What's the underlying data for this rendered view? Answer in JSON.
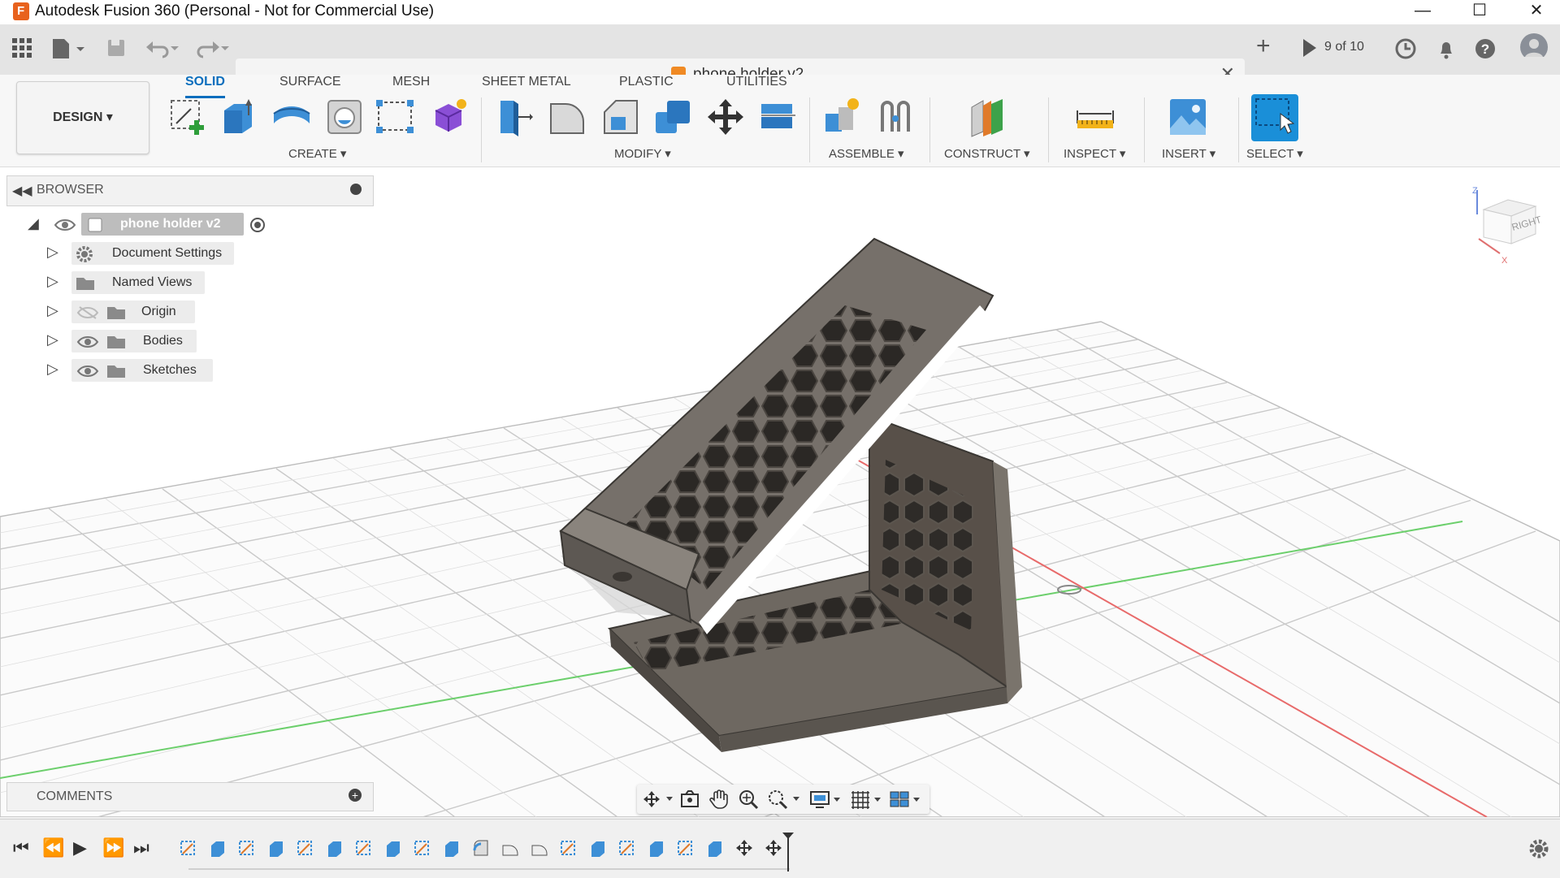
{
  "window": {
    "title": "Autodesk Fusion 360 (Personal - Not for Commercial Use)",
    "logo_letter": "F",
    "minimize_glyph": "—",
    "maximize_glyph": "☐",
    "close_glyph": "✕"
  },
  "tabbar": {
    "document_name": "phone holder v2",
    "close_glyph": "✕",
    "new_tab_glyph": "+",
    "job_status": "9 of 10"
  },
  "ribbon": {
    "workspace": "DESIGN ▾",
    "tabs": [
      "SOLID",
      "SURFACE",
      "MESH",
      "SHEET METAL",
      "PLASTIC",
      "UTILITIES"
    ],
    "active_tab": "SOLID",
    "groups": [
      "CREATE ▾",
      "MODIFY ▾",
      "ASSEMBLE ▾",
      "CONSTRUCT ▾",
      "INSPECT ▾",
      "INSERT ▾",
      "SELECT ▾"
    ]
  },
  "browser": {
    "label": "BROWSER",
    "root": "phone holder v2",
    "items": [
      {
        "label": "Document Settings",
        "icon": "gear-icon"
      },
      {
        "label": "Named Views",
        "icon": "folder-icon"
      },
      {
        "label": "Origin",
        "icon": "folder-icon",
        "hidden": true
      },
      {
        "label": "Bodies",
        "icon": "folder-icon"
      },
      {
        "label": "Sketches",
        "icon": "folder-icon"
      }
    ]
  },
  "viewcube": {
    "face_label": "RIGHT",
    "axis_z": "Z",
    "axis_x": "X"
  },
  "comments": {
    "label": "COMMENTS",
    "add_glyph": "+"
  },
  "colors": {
    "accent": "#0a6ebd",
    "model": "#6b655e",
    "grid": "#c8c8c8",
    "x_axis": "#e06060",
    "y_axis": "#60cc60"
  }
}
